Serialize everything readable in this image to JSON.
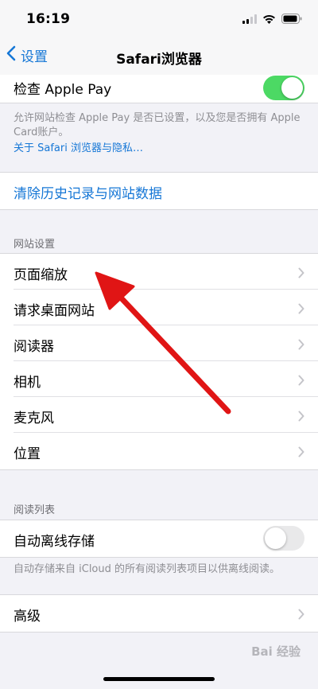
{
  "status_bar": {
    "time": "16:19"
  },
  "nav": {
    "back_label": "设置",
    "title": "Safari浏览器"
  },
  "apple_pay": {
    "label": "检查 Apple Pay",
    "enabled": true,
    "note": "允许网站检查 Apple Pay 是否已设置，以及您是否拥有 Apple Card账户。",
    "link": "关于 Safari 浏览器与隐私…"
  },
  "clear_history": {
    "label": "清除历史记录与网站数据"
  },
  "website_settings": {
    "header": "网站设置",
    "items": [
      {
        "label": "页面缩放"
      },
      {
        "label": "请求桌面网站"
      },
      {
        "label": "阅读器"
      },
      {
        "label": "相机"
      },
      {
        "label": "麦克风"
      },
      {
        "label": "位置"
      }
    ]
  },
  "reading_list": {
    "header": "阅读列表",
    "auto_save_label": "自动离线存储",
    "auto_save_enabled": false,
    "note": "自动存储来自 iCloud 的所有阅读列表项目以供离线阅读。"
  },
  "advanced": {
    "label": "高级"
  },
  "watermark": "Bai 经验",
  "colors": {
    "accent": "#1677d6",
    "toggle_on": "#4cd964",
    "arrow": "#e01515"
  }
}
